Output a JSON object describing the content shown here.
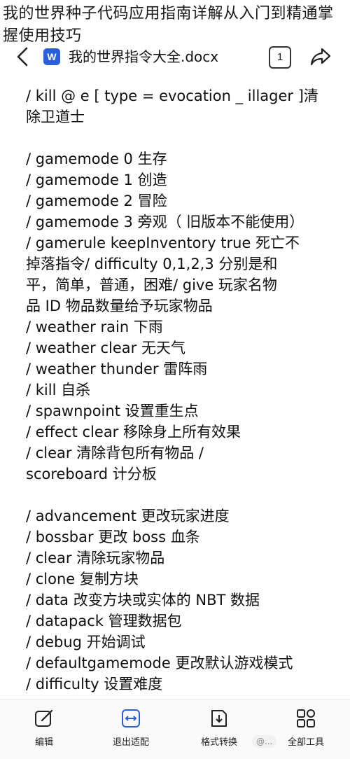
{
  "overlay_title": "我的世界种子代码应用指南详解从入门到精通掌握使用技巧",
  "header": {
    "app_badge": "W",
    "doc_title": "我的世界指令大全.docx",
    "page_count": "1"
  },
  "document": {
    "lines": [
      "/ kill @ e [ type = evocation _ illager ]清",
      "除卫道士",
      "",
      "/ gamemode 0 生存",
      "/ gamemode 1 创造",
      "/ gamemode 2 冒险",
      "/ gamemode 3 旁观（  旧版本不能使用）",
      "/ gamerule keepInventory true  死亡不",
      "掉落指令/ difficulty 0,1,2,3 分别是和",
      "平，简单，普通，困难/ give  玩家名物",
      "品  ID  物品数量给予玩家物品",
      "/ weather rain  下雨",
      "/ weather clear  无天气",
      "/ weather thunder  雷阵雨",
      "/ kill  自杀",
      "/ spawnpoint  设置重生点",
      "/ effect clear  移除身上所有效果",
      "/ clear  清除背包所有物品        /",
      "scoreboard  计分板",
      "",
      "/ advancement  更改玩家进度",
      "/ bossbar  更改  boss  血条",
      "/ clear  清除玩家物品",
      "/ clone  复制方块",
      "/ data  改变方块或实体的  NBT  数据",
      "/ datapack  管理数据包",
      "/ debug  开始调试",
      "/ defaultgamemode  更改默认游戏模式",
      "/ difficulty  设置难度"
    ]
  },
  "toolbar": {
    "edit_label": "编辑",
    "exit_fit_label": "退出适配",
    "convert_label": "格式转换",
    "all_tools_label": "全部工具"
  },
  "watermark": "@..."
}
